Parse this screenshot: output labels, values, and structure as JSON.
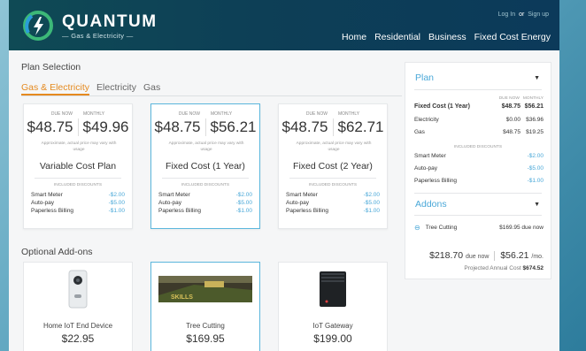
{
  "header": {
    "brand": "QUANTUM",
    "brand_sub": "Gas & Electricity",
    "login": "Log In",
    "or": "or",
    "signup": "Sign up",
    "nav": [
      "Home",
      "Residential",
      "Business",
      "Fixed Cost Energy"
    ]
  },
  "plan_selection": {
    "title": "Plan Selection",
    "tabs": [
      "Gas & Electricity",
      "Electricity",
      "Gas"
    ],
    "active_tab": "Gas & Electricity",
    "cards": [
      {
        "due_label": "DUE NOW",
        "monthly_label": "MONTHLY",
        "due": "$48.75",
        "monthly": "$49.96",
        "note": "Approximate, actual price may vary with usage",
        "name": "Variable Cost Plan",
        "discounts_label": "INCLUDED DISCOUNTS",
        "discounts": [
          {
            "label": "Smart Meter",
            "value": "-$2.00"
          },
          {
            "label": "Auto-pay",
            "value": "-$5.00"
          },
          {
            "label": "Paperless Billing",
            "value": "-$1.00"
          }
        ]
      },
      {
        "due_label": "DUE NOW",
        "monthly_label": "MONTHLY",
        "due": "$48.75",
        "monthly": "$56.21",
        "note": "Approximate, actual price may vary with usage",
        "name": "Fixed Cost (1 Year)",
        "discounts_label": "INCLUDED DISCOUNTS",
        "discounts": [
          {
            "label": "Smart Meter",
            "value": "-$2.00"
          },
          {
            "label": "Auto-pay",
            "value": "-$5.00"
          },
          {
            "label": "Paperless Billing",
            "value": "-$1.00"
          }
        ]
      },
      {
        "due_label": "DUE NOW",
        "monthly_label": "MONTHLY",
        "due": "$48.75",
        "monthly": "$62.71",
        "note": "Approximate, actual price may vary with usage",
        "name": "Fixed Cost (2 Year)",
        "discounts_label": "INCLUDED DISCOUNTS",
        "discounts": [
          {
            "label": "Smart Meter",
            "value": "-$2.00"
          },
          {
            "label": "Auto-pay",
            "value": "-$5.00"
          },
          {
            "label": "Paperless Billing",
            "value": "-$1.00"
          }
        ]
      }
    ],
    "selected_card": 1
  },
  "addons_section": {
    "title": "Optional Add-ons",
    "items": [
      {
        "name": "Home IoT End Device",
        "price": "$22.95",
        "icon": "doorbell-device-image"
      },
      {
        "name": "Tree Cutting",
        "price": "$169.95",
        "icon": "tree-cutting-image",
        "image_text": "SKILLS"
      },
      {
        "name": "IoT Gateway",
        "price": "$199.00",
        "icon": "gateway-device-image"
      }
    ],
    "selected_item": 1
  },
  "summary": {
    "plan_title": "Plan",
    "due_now_label": "DUE NOW",
    "monthly_label": "MONTHLY",
    "rows": [
      {
        "label": "Fixed Cost (1 Year)",
        "due": "$48.75",
        "monthly": "$56.21"
      },
      {
        "label": "Electricity",
        "due": "$0.00",
        "monthly": "$36.96"
      },
      {
        "label": "Gas",
        "due": "$48.75",
        "monthly": "$19.25"
      }
    ],
    "discounts_label": "INCLUDED DISCOUNTS",
    "discounts": [
      {
        "label": "Smart Meter",
        "value": "-$2.00"
      },
      {
        "label": "Auto-pay",
        "value": "-$5.00"
      },
      {
        "label": "Paperless Billing",
        "value": "-$1.00"
      }
    ],
    "addons_title": "Addons",
    "addon_item": {
      "label": "Tree Cutting",
      "value": "$169.95 due now"
    },
    "total_due": "$218.70",
    "due_now_text": "due now",
    "total_monthly": "$56.21",
    "per_month": "/mo.",
    "projected_label": "Projected Annual Cost",
    "projected_value": "$674.52"
  },
  "colors": {
    "accent": "#4aa8d8",
    "active_tab": "#e58a1f",
    "header": "#0d3f56"
  }
}
